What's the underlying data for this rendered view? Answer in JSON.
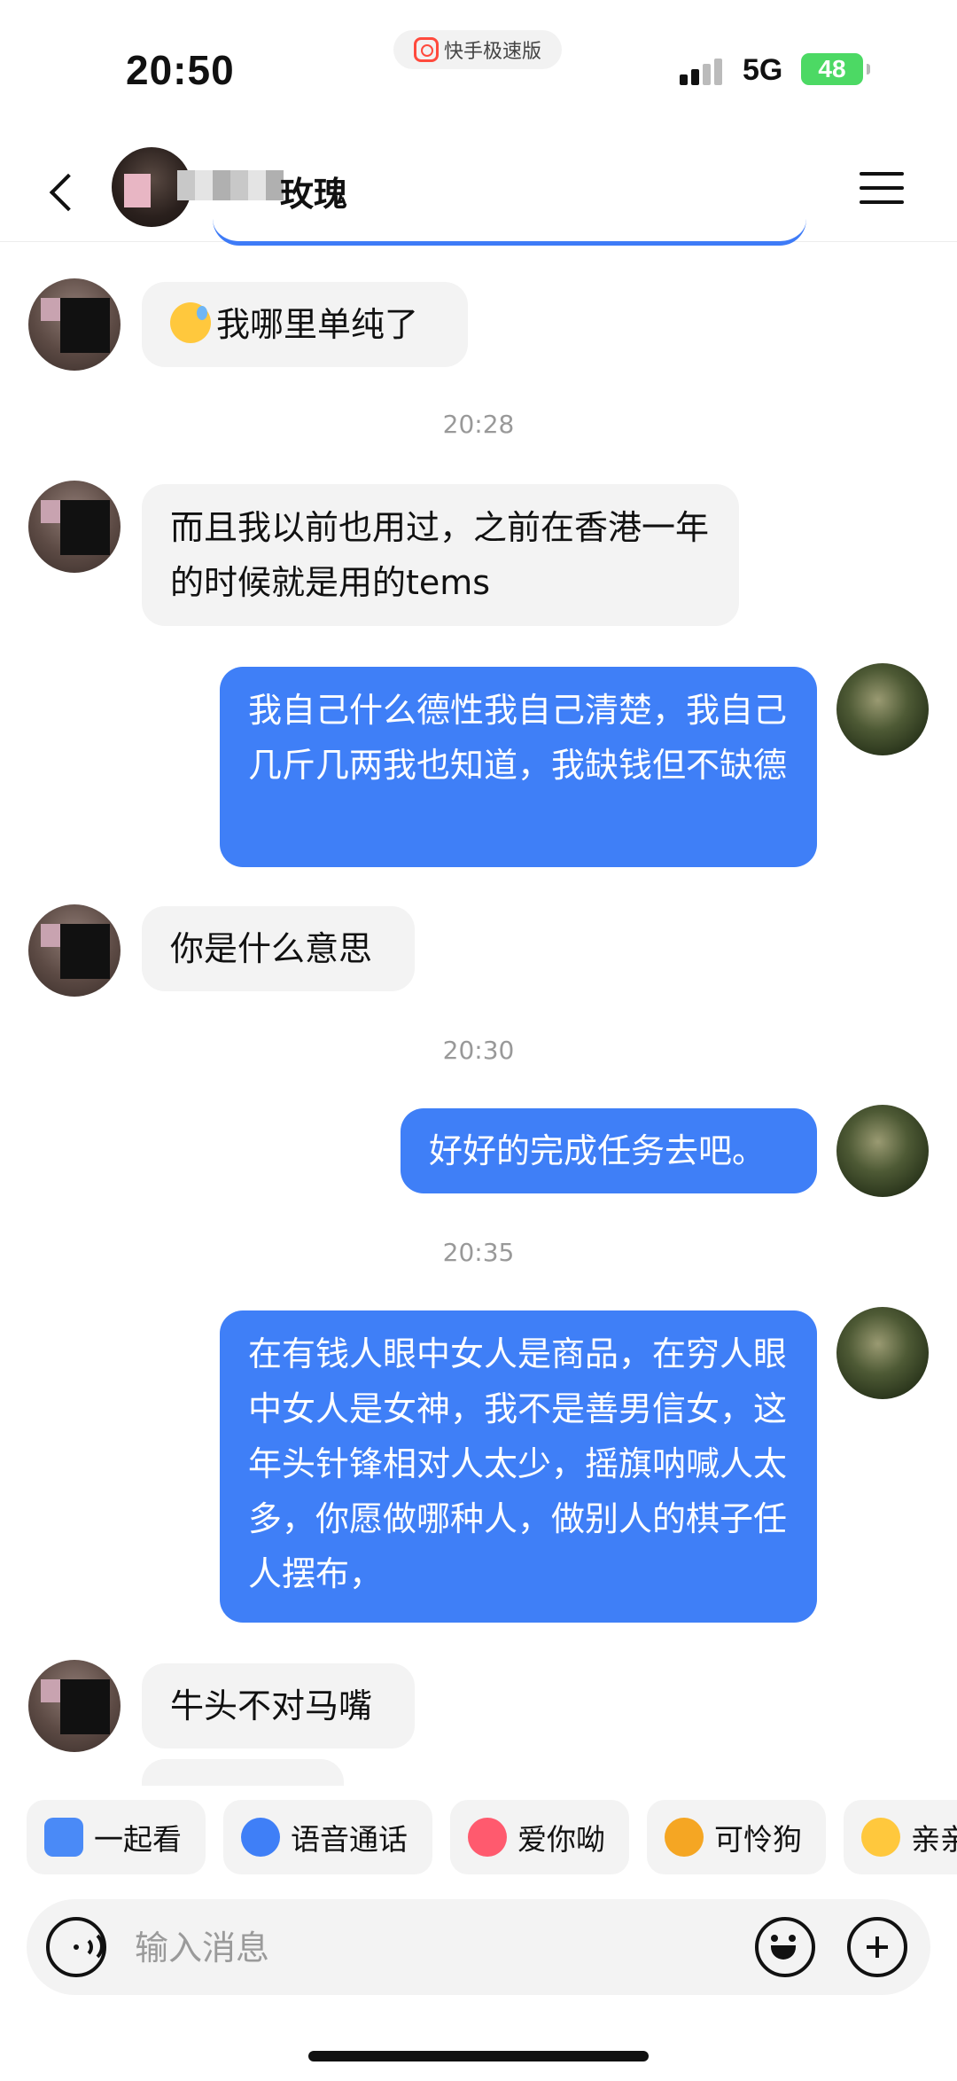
{
  "status_bar": {
    "time": "20:50",
    "app_name": "快手极速版",
    "network": "5G",
    "battery": "48"
  },
  "header": {
    "title": "玫瑰"
  },
  "messages": [
    {
      "side": "in",
      "text": "我哪里单纯了",
      "emoji": "sweat-face"
    },
    {
      "type": "time",
      "text": "20:28"
    },
    {
      "side": "in",
      "text": "而且我以前也用过，之前在香港一年的时候就是用的tems"
    },
    {
      "side": "out",
      "text": "我自己什么德性我自己清楚，我自己几斤几两我也知道，我缺钱但不缺德"
    },
    {
      "side": "in",
      "text": "你是什么意思"
    },
    {
      "type": "time",
      "text": "20:30"
    },
    {
      "side": "out",
      "text": "好好的完成任务去吧。"
    },
    {
      "type": "time",
      "text": "20:35"
    },
    {
      "side": "out",
      "text": "在有钱人眼中女人是商品，在穷人眼中女人是女神，我不是善男信女，这年头针锋相对人太少，摇旗呐喊人太多，你愿做哪种人，做别人的棋子任人摆布，"
    },
    {
      "side": "in",
      "text": "牛头不对马嘴"
    }
  ],
  "quick_actions": [
    {
      "label": "一起看",
      "icon": "watch-together-icon",
      "color": "#4a8af7"
    },
    {
      "label": "语音通话",
      "icon": "phone-icon",
      "color": "#3f7ff7"
    },
    {
      "label": "爱你呦",
      "icon": "love-emoji-icon",
      "color": "#ff5a6e"
    },
    {
      "label": "可怜狗",
      "icon": "dog-emoji-icon",
      "color": "#f5a623"
    },
    {
      "label": "亲亲",
      "icon": "hug-emoji-icon",
      "color": "#ffc83d"
    }
  ],
  "input": {
    "placeholder": "输入消息"
  },
  "colors": {
    "outgoing_bubble": "#3f7ff7",
    "incoming_bubble": "#f3f3f3",
    "battery": "#4cd964"
  }
}
